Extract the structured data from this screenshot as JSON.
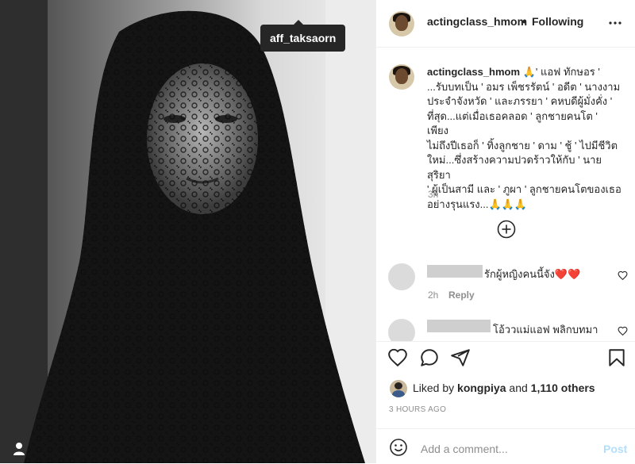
{
  "photo": {
    "tagged_user": "aff_taksaorn",
    "user_tag_icon": "person-icon"
  },
  "header": {
    "username": "actingclass_hmom",
    "dot": "•",
    "follow_status": "Following",
    "more_icon": "more-horizontal-icon"
  },
  "caption": {
    "username": "actingclass_hmom",
    "text": " 🙏' แอฟ ทักษอร '\n...รับบทเป็น ' อมร เพ็ชรรัตน์ ' อดีต ' นางงาม\nประจำจังหวัด ' และภรรยา ' คหบดีผู้มั่งคั่ง '\nที่สุด...แต่เมื่อเธอคลอด ' ลูกชายคนโต ' เพียง\nไม่ถึงปีเธอก็ ' ทิ้งลูกชาย ' ดาม ' ชู้ ' ไปมีชีวิต\nใหม่...ซึ่งสร้างความปวดร้าวให้กับ ' นายสุริยา\n' ผู้เป็นสามี และ ' ภูผา ' ลูกชายคนโตของเธอ\nอย่างรุนแรง...🙏🙏🙏",
    "time": "3h"
  },
  "load_more_icon": "plus-circle-icon",
  "comments": [
    {
      "text": "รักผู้หญิงคนนี้จัง❤️❤️",
      "time": "2h",
      "reply": "Reply"
    },
    {
      "text": "โอ้ววแม่แอฟ พลิกบทมา"
    }
  ],
  "actions": {
    "like_icon": "heart-icon",
    "comment_icon": "comment-icon",
    "share_icon": "send-icon",
    "save_icon": "bookmark-icon"
  },
  "likes": {
    "prefix": "Liked by ",
    "user": "kongpiya",
    "middle": " and ",
    "others": "1,110 others"
  },
  "posted_ago": "3 HOURS AGO",
  "comment_input": {
    "emoji_icon": "smile-icon",
    "placeholder": "Add a comment...",
    "post_label": "Post"
  },
  "colors": {
    "link_blue_disabled": "#b2dffc",
    "muted": "#8e8e8e",
    "text": "#262626"
  }
}
